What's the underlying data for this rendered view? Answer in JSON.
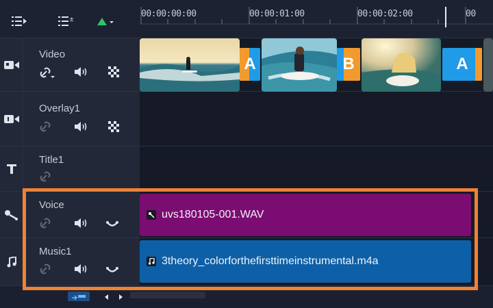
{
  "toolbar": {
    "buttons": [
      {
        "name": "track-manager-icon"
      },
      {
        "name": "chapter-marker-icon"
      },
      {
        "name": "add-track-icon"
      }
    ],
    "accent": "#2ec36b"
  },
  "ruler": {
    "ticks": [
      "00:00:00:00",
      "00:00:01:00",
      "00:00:02:00",
      "00"
    ]
  },
  "tracks": [
    {
      "id": "video",
      "name": "Video"
    },
    {
      "id": "overlay1",
      "name": "Overlay1"
    },
    {
      "id": "title1",
      "name": "Title1"
    },
    {
      "id": "voice",
      "name": "Voice"
    },
    {
      "id": "music1",
      "name": "Music1"
    }
  ],
  "video_lane": {
    "transitions": [
      "A",
      "B",
      "A"
    ]
  },
  "audio_clips": {
    "voice": {
      "label": "uvs180105-001.WAV",
      "color": "#7b0c72"
    },
    "music": {
      "label": "3theory_colorforthefirsttimeinstrumental.m4a",
      "color": "#0d60a8"
    }
  },
  "colors": {
    "highlight": "#ee8236",
    "transition_orange": "#f29a2e",
    "transition_blue": "#1f9be8"
  }
}
